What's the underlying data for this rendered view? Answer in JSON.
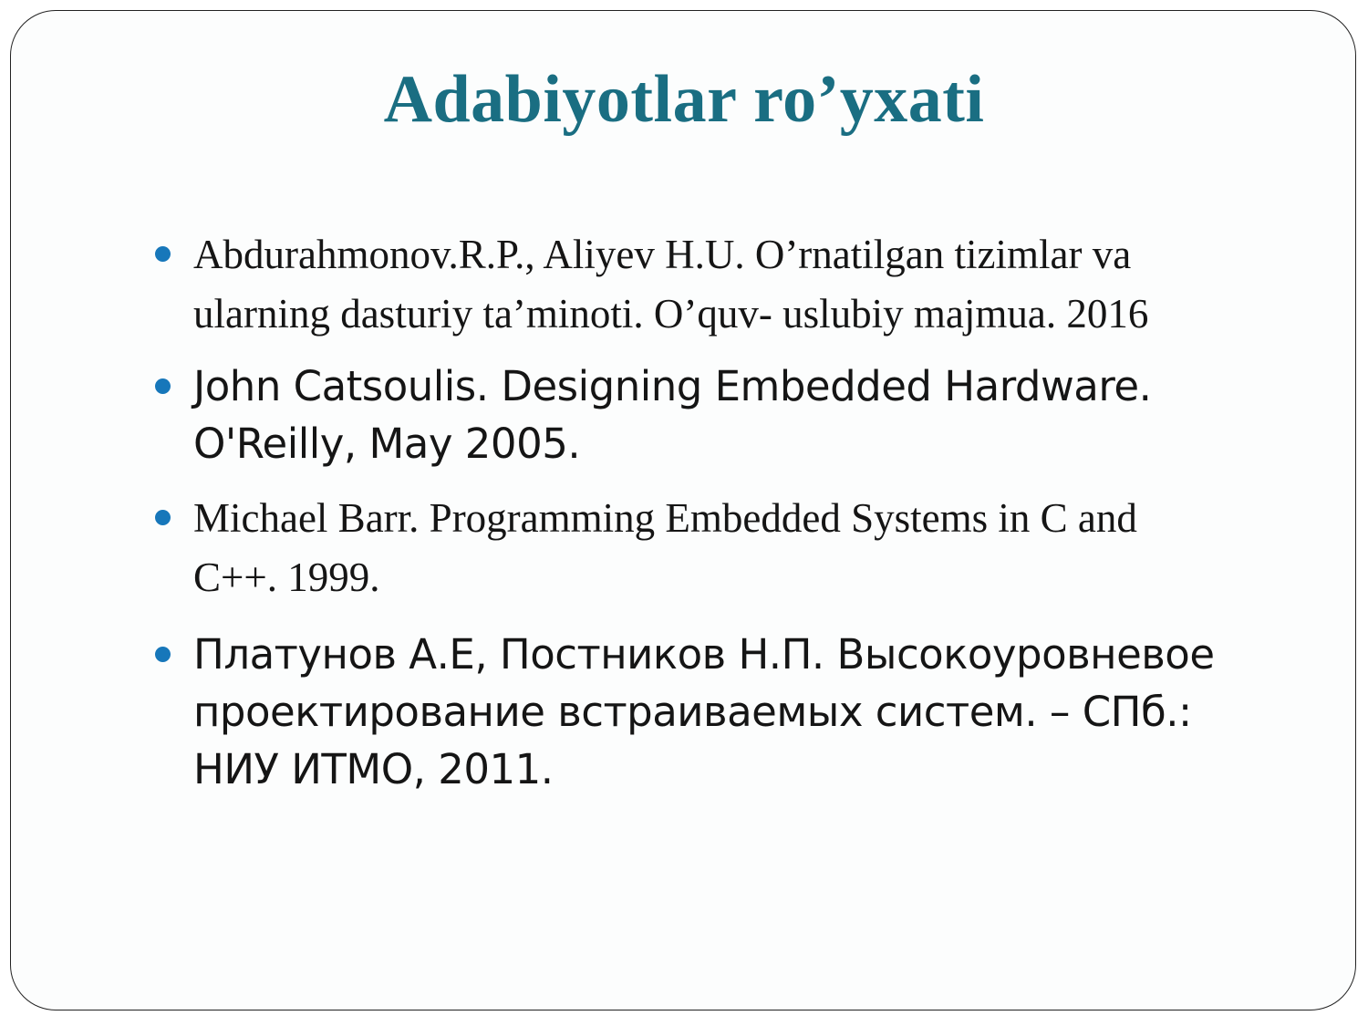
{
  "slide": {
    "title": "Adabiyotlar ro’yxati",
    "title_color": "#1a6e82",
    "bullet_color": "#1777ba",
    "references": [
      {
        "line1": "Abdurahmonov.R.P., Aliyev H.U. O’rnatilgan tizimlar va",
        "line2": "ularning dasturiy ta’minoti. O’quv- uslubiy majmua. 2016"
      },
      {
        "line1": "John Catsoulis. Designing Embedded Hardware.",
        "line2": "O'Reilly, May 2005."
      },
      {
        "line1": "Michael Barr. Programming Embedded Systems in C and",
        "line2": "C++. 1999."
      },
      {
        "line1": "Платунов А.Е, Постников Н.П. Высокоуровневое",
        "line2": "проектирование встраиваемых систем. – СПб.:",
        "line3": "НИУ ИТМО, 2011."
      }
    ]
  }
}
